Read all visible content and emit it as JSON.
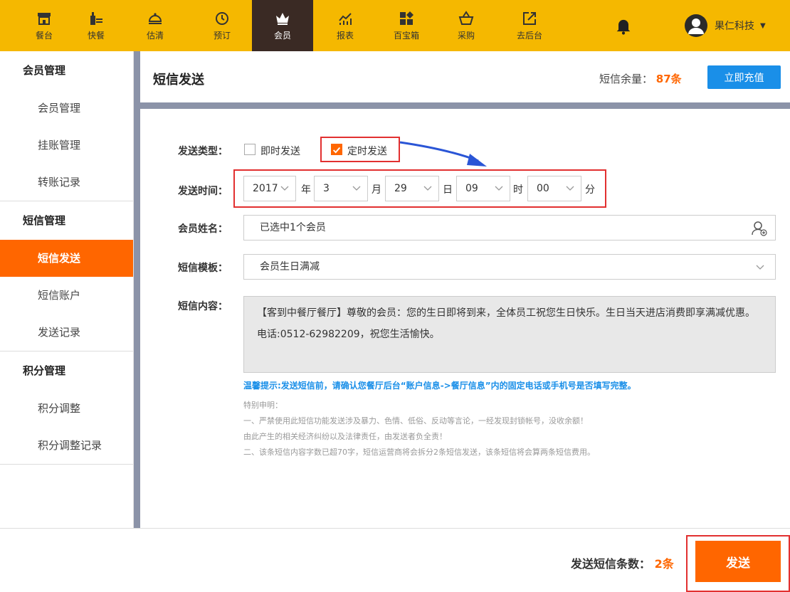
{
  "nav": {
    "items": [
      {
        "label": "餐台",
        "icon": "table-icon"
      },
      {
        "label": "快餐",
        "icon": "fastfood-icon"
      },
      {
        "label": "估清",
        "icon": "cloche-icon"
      },
      {
        "label": "预订",
        "icon": "clock-icon"
      },
      {
        "label": "会员",
        "icon": "crown-icon"
      },
      {
        "label": "报表",
        "icon": "chart-icon"
      },
      {
        "label": "百宝箱",
        "icon": "grid-icon"
      },
      {
        "label": "采购",
        "icon": "basket-icon"
      },
      {
        "label": "去后台",
        "icon": "external-icon"
      }
    ],
    "active_index": 4,
    "user_name": "果仁科技",
    "bell_icon": "bell-icon"
  },
  "sidebar": {
    "groups": [
      {
        "title": "会员管理",
        "items": [
          "会员管理",
          "挂账管理",
          "转账记录"
        ]
      },
      {
        "title": "短信管理",
        "items": [
          "短信发送",
          "短信账户",
          "发送记录"
        ]
      },
      {
        "title": "积分管理",
        "items": [
          "积分调整",
          "积分调整记录"
        ]
      }
    ],
    "active_item": "短信发送"
  },
  "header": {
    "title": "短信发送",
    "balance_label": "短信余量：",
    "balance_value": "87条",
    "recharge_label": "立即充值"
  },
  "form": {
    "send_type_label": "发送类型：",
    "option_immediate": "即时发送",
    "option_scheduled": "定时发送",
    "scheduled_checked": true,
    "send_time_label": "发送时间：",
    "year": "2017",
    "year_unit": "年",
    "month": "3",
    "month_unit": "月",
    "day": "29",
    "day_unit": "日",
    "hour": "09",
    "hour_unit": "时",
    "minute": "00",
    "minute_unit": "分",
    "member_label": "会员姓名：",
    "member_value": "已选中1个会员",
    "template_label": "短信模板：",
    "template_value": "会员生日满减",
    "content_label": "短信内容：",
    "content_value": "【客到中餐厅餐厅】尊敬的会员：您的生日即将到来，全体员工祝您生日快乐。生日当天进店消费即享满减优惠。电话:0512-62982209，祝您生活愉快。"
  },
  "tips": {
    "warm_tip": "温馨提示:发送短信前，请确认您餐厅后台“账户信息->餐厅信息”内的固定电话或手机号是否填写完整。",
    "notice_title": "特别申明：",
    "notice_1": "一、严禁使用此短信功能发送涉及暴力、色情、低俗、反动等言论，一经发现封锁帐号，没收余额！",
    "notice_2": "由此产生的相关经济纠纷以及法律责任，由发送者负全责！",
    "notice_3": "二、该条短信内容字数已超70字，短信运营商将会拆分2条短信发送，该条短信将会算两条短信费用。"
  },
  "footer": {
    "count_label": "发送短信条数：",
    "count_value": "2条",
    "send_label": "发送"
  },
  "colors": {
    "accent": "#ff6600",
    "topbar": "#f5b800",
    "link": "#1a8fe8",
    "highlight": "#e23030"
  }
}
